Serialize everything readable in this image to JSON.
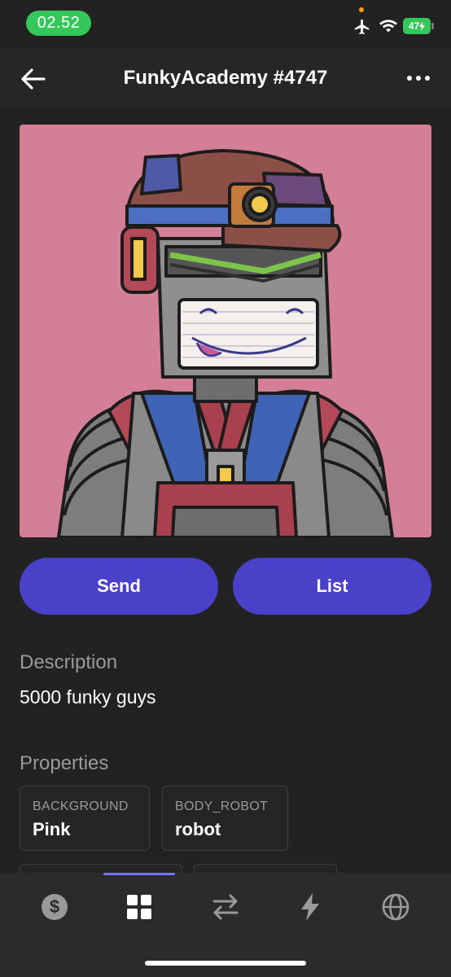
{
  "status_bar": {
    "time": "02.52",
    "battery": "47",
    "icons": [
      "airplane-icon",
      "wifi-icon",
      "battery-icon"
    ]
  },
  "header": {
    "title": "FunkyAcademy #4747",
    "back_icon": "arrow-left-icon",
    "more_icon": "more-horizontal-icon"
  },
  "actions": {
    "send_label": "Send",
    "list_label": "List"
  },
  "description": {
    "heading": "Description",
    "text": "5000 funky guys"
  },
  "properties": {
    "heading": "Properties",
    "items": [
      {
        "key": "BACKGROUND",
        "value": "Pink"
      },
      {
        "key": "BODY_ROBOT",
        "value": "robot"
      }
    ]
  },
  "bottom_nav": {
    "items": [
      {
        "icon": "dollar-icon",
        "active": false
      },
      {
        "icon": "grid-icon",
        "active": true
      },
      {
        "icon": "swap-arrows-icon",
        "active": false
      },
      {
        "icon": "lightning-icon",
        "active": false
      },
      {
        "icon": "globe-icon",
        "active": false
      }
    ]
  },
  "colors": {
    "background": "#222222",
    "accent": "#4a41c9",
    "artwork_background": "#d37f95",
    "status_green": "#34c759"
  }
}
